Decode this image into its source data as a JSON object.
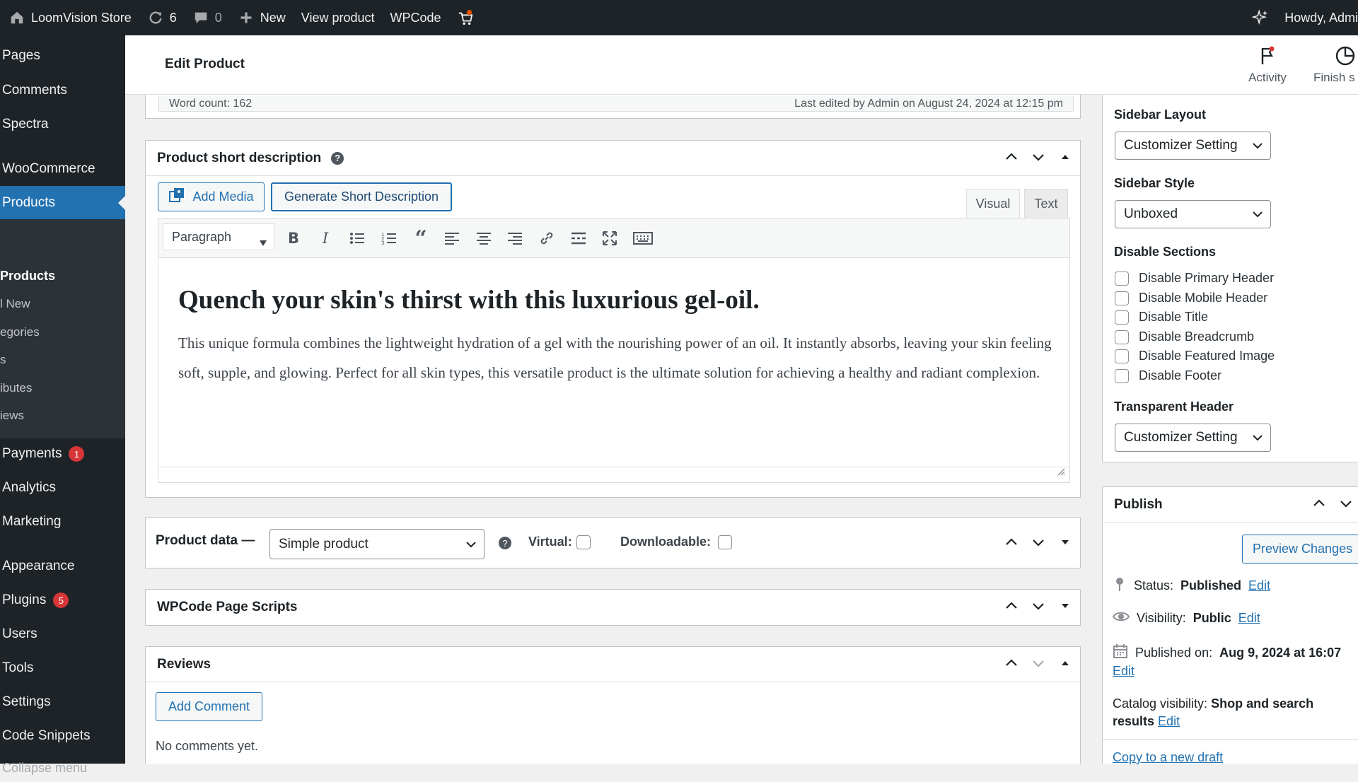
{
  "adminbar": {
    "site_name": "LoomVision Store",
    "updates_count": "6",
    "comments_count": "0",
    "new_label": "New",
    "view_product_label": "View product",
    "wpcode_label": "WPCode",
    "howdy": "Howdy, Admi"
  },
  "sidebar": {
    "items": [
      {
        "label": "Pages"
      },
      {
        "label": "Comments"
      },
      {
        "label": "Spectra"
      },
      {
        "label": "WooCommerce"
      },
      {
        "label": "Products"
      },
      {
        "label": "Payments",
        "badge": "1"
      },
      {
        "label": "Analytics"
      },
      {
        "label": "Marketing"
      },
      {
        "label": "Appearance"
      },
      {
        "label": "Plugins",
        "badge": "5"
      },
      {
        "label": "Users"
      },
      {
        "label": "Tools"
      },
      {
        "label": "Settings"
      },
      {
        "label": "Code Snippets"
      },
      {
        "label": "Collapse menu"
      }
    ],
    "submenu": [
      "Products",
      "l New",
      "egories",
      "s",
      "ibutes",
      "iews"
    ]
  },
  "header": {
    "title": "Edit Product",
    "activity_label": "Activity",
    "finish_label": "Finish s"
  },
  "wordcount": {
    "count": "Word count: 162",
    "last_edited": "Last edited by Admin on August 24, 2024 at 12:15 pm"
  },
  "short_desc": {
    "title": "Product short description",
    "add_media": "Add Media",
    "generate": "Generate Short Description",
    "tab_visual": "Visual",
    "tab_text": "Text",
    "format_select": "Paragraph",
    "heading": "Quench your skin's thirst with this luxurious gel-oil.",
    "body": "This unique formula combines the lightweight hydration of a gel with the nourishing power of an oil. It instantly absorbs, leaving your skin feeling soft, supple, and glowing. Perfect for all skin types, this versatile product is the ultimate solution for achieving a healthy and radiant complexion."
  },
  "product_data": {
    "label": "Product data —",
    "type": "Simple product",
    "virtual_label": "Virtual:",
    "downloadable_label": "Downloadable:"
  },
  "wpcode_box": {
    "title": "WPCode Page Scripts"
  },
  "reviews": {
    "title": "Reviews",
    "add_comment": "Add Comment",
    "empty": "No comments yet."
  },
  "layout_panel": {
    "sidebar_layout_label": "Sidebar Layout",
    "sidebar_layout_value": "Customizer Setting",
    "sidebar_style_label": "Sidebar Style",
    "sidebar_style_value": "Unboxed",
    "disable_sections_label": "Disable Sections",
    "disable_options": [
      "Disable Primary Header",
      "Disable Mobile Header",
      "Disable Title",
      "Disable Breadcrumb",
      "Disable Featured Image",
      "Disable Footer"
    ],
    "transparent_header_label": "Transparent Header",
    "transparent_header_value": "Customizer Setting"
  },
  "publish": {
    "title": "Publish",
    "preview": "Preview Changes",
    "status_label": "Status:",
    "status_value": "Published",
    "visibility_label": "Visibility:",
    "visibility_value": "Public",
    "published_label": "Published on:",
    "published_value": "Aug 9, 2024 at 16:07",
    "edit": "Edit",
    "catalog_label": "Catalog visibility:",
    "catalog_value": "Shop and search results",
    "copy_draft": "Copy to a new draft"
  },
  "colors": {
    "admin_dark": "#1d2327",
    "accent_blue": "#2271b1",
    "badge_red": "#d63638"
  }
}
